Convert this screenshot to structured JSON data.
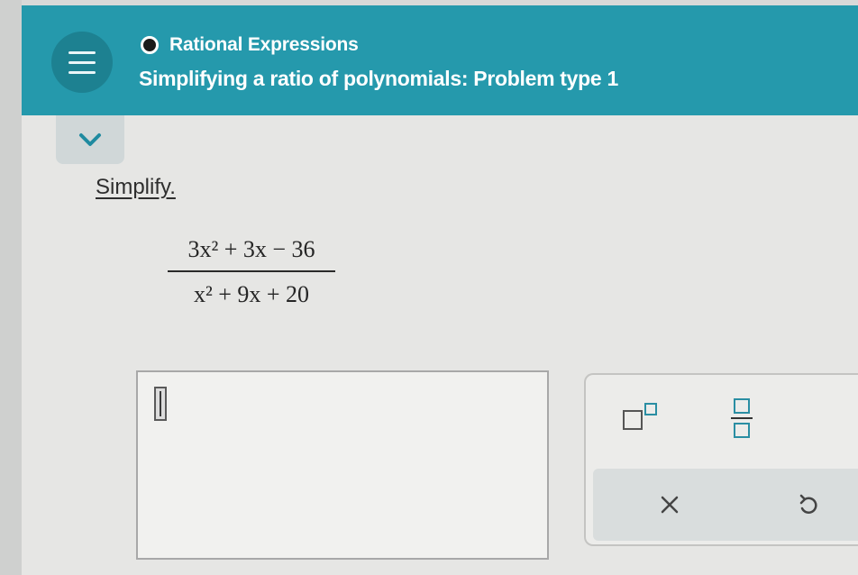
{
  "header": {
    "topic": "Rational Expressions",
    "problem_title": "Simplifying a ratio of polynomials: Problem type 1"
  },
  "problem": {
    "instruction": "Simplify.",
    "numerator": "3x² + 3x − 36",
    "denominator": "x² + 9x + 20"
  },
  "answer": {
    "value": ""
  },
  "keypad": {
    "buttons": [
      "exponent-icon",
      "fraction-icon",
      "clear-icon",
      "undo-icon"
    ]
  },
  "colors": {
    "header_bg": "#2599ac",
    "menu_button_bg": "#1d8191",
    "page_bg": "#e6e6e4"
  }
}
